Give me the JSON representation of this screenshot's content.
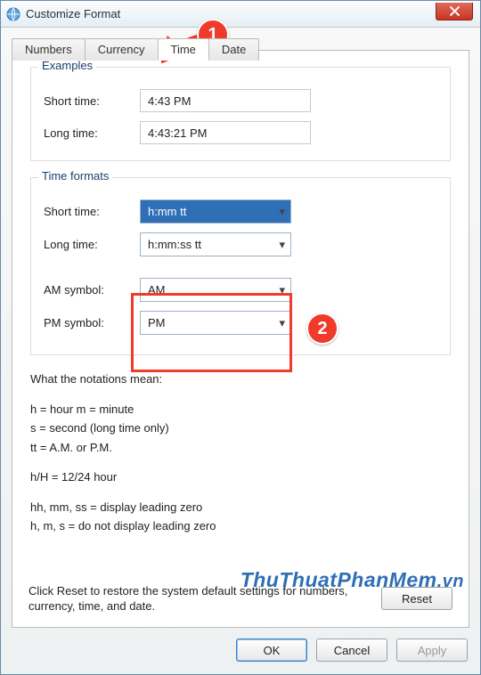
{
  "titlebar": {
    "title": "Customize Format"
  },
  "tabs": [
    {
      "label": "Numbers"
    },
    {
      "label": "Currency"
    },
    {
      "label": "Time"
    },
    {
      "label": "Date"
    }
  ],
  "active_tab_index": 2,
  "examples": {
    "legend": "Examples",
    "short_label": "Short time:",
    "short_value": "4:43 PM",
    "long_label": "Long time:",
    "long_value": "4:43:21 PM"
  },
  "formats": {
    "legend": "Time formats",
    "short_label": "Short time:",
    "short_value": "h:mm tt",
    "long_label": "Long time:",
    "long_value": "h:mm:ss tt",
    "am_label": "AM symbol:",
    "am_value": "AM",
    "pm_label": "PM symbol:",
    "pm_value": "PM"
  },
  "notations": {
    "heading": "What the notations mean:",
    "l1": "h = hour    m = minute",
    "l2": "s = second (long time only)",
    "l3": "tt = A.M. or P.M.",
    "l4": "h/H = 12/24 hour",
    "l5": "hh, mm, ss = display leading zero",
    "l6": "h, m, s = do not display leading zero"
  },
  "reset": {
    "text": "Click Reset to restore the system default settings for numbers, currency, time, and date.",
    "button": "Reset"
  },
  "buttons": {
    "ok": "OK",
    "cancel": "Cancel",
    "apply": "Apply"
  },
  "callouts": {
    "one": "1",
    "two": "2"
  },
  "watermark": {
    "a": "ThuThuat",
    "b": "PhanMem",
    "c": ".vn"
  }
}
